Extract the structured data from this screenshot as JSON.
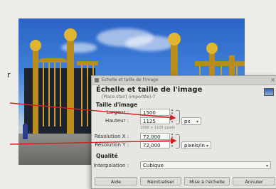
{
  "left_fragment": "r",
  "dialog": {
    "title": "Échelle et taille de l'image",
    "heading": "Échelle et taille de l'image",
    "subheading": "[Place stan] (importée)-7",
    "image_size_section": "Taille d'image",
    "width_label": "Largeur :",
    "width_value": "1500",
    "height_label": "Hauteur :",
    "height_value": "1125",
    "unit": "px",
    "dims_hint": "1500 × 1125 pixels",
    "res_x_label": "Résolution X :",
    "res_x_value": "72,000",
    "res_y_label": "Résolution Y :",
    "res_y_value": "72,000",
    "res_unit": "pixels/in",
    "quality_section": "Qualité",
    "interp_label": "Interpolation :",
    "interp_value": "Cubique",
    "buttons": {
      "help": "Aide",
      "reset": "Réinitialiser",
      "scale": "Mise à l'échelle",
      "cancel": "Annuler"
    }
  },
  "colors": {
    "arrow": "#d42020",
    "dialog_bg": "#e6e6e3",
    "gold": "#c9a127"
  }
}
